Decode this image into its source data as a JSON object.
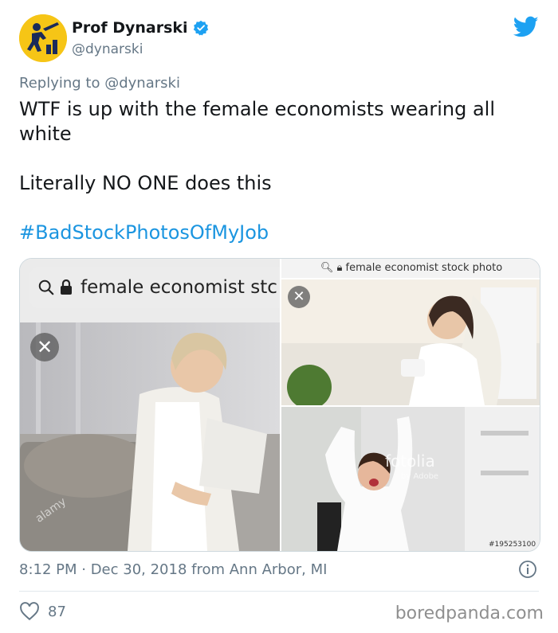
{
  "author": {
    "display_name": "Prof Dynarski",
    "handle": "@dynarski",
    "verified": true
  },
  "reply": {
    "prefix": "Replying to",
    "mention": "@dynarski"
  },
  "tweet": {
    "line1": "WTF is up with the female economists wearing all white",
    "line2": "Literally NO ONE does this",
    "hashtag": "#BadStockPhotosOfMyJob"
  },
  "media": {
    "left_search_text": "female economist stc",
    "right_url_text": "female economist stock photo",
    "watermark_left": "alamy",
    "watermark_right": "fotolia",
    "watermark_right_sub": "by Adobe",
    "right_id": "#195253100"
  },
  "meta": {
    "timestamp": "8:12 PM · Dec 30, 2018 from Ann Arbor, MI"
  },
  "engagement": {
    "likes": "87"
  },
  "site_watermark": "boredpanda.com",
  "colors": {
    "link": "#1b95e0",
    "twitter_blue": "#1da1f2",
    "muted": "#657786",
    "avatar_bg": "#f6c516"
  }
}
